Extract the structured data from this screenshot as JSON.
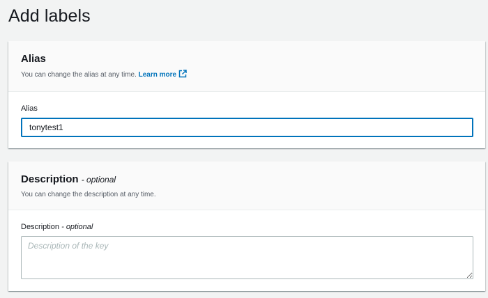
{
  "page": {
    "title": "Add labels"
  },
  "alias_panel": {
    "heading": "Alias",
    "subtitle": "You can change the alias at any time.",
    "learn_more": "Learn more",
    "field_label": "Alias",
    "field_value": "tonytest1",
    "icon": "external-link-icon"
  },
  "description_panel": {
    "heading": "Description",
    "heading_optional": "- optional",
    "subtitle": "You can change the description at any time.",
    "field_label": "Description",
    "field_optional": "- optional",
    "placeholder": "Description of the key"
  },
  "colors": {
    "accent": "#0073bb",
    "background": "#f2f3f3"
  }
}
